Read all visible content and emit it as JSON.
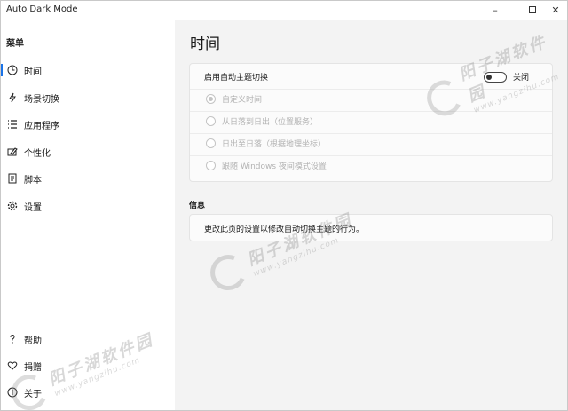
{
  "window": {
    "title": "Auto Dark Mode",
    "minimize": "–",
    "close": "✕"
  },
  "sidebar": {
    "header": "菜单",
    "items": [
      {
        "label": "时间",
        "icon": "clock-icon"
      },
      {
        "label": "场景切换",
        "icon": "lightning-icon"
      },
      {
        "label": "应用程序",
        "icon": "list-icon"
      },
      {
        "label": "个性化",
        "icon": "paint-icon"
      },
      {
        "label": "脚本",
        "icon": "script-icon"
      },
      {
        "label": "设置",
        "icon": "gear-icon"
      }
    ],
    "footer": [
      {
        "label": "帮助",
        "icon": "question-icon"
      },
      {
        "label": "捐赠",
        "icon": "heart-icon"
      },
      {
        "label": "关于",
        "icon": "info-icon"
      }
    ]
  },
  "main": {
    "title": "时间",
    "auto_switch": {
      "label": "启用自动主题切换",
      "toggle_label": "关闭",
      "enabled": false
    },
    "options": [
      {
        "label": "自定义时间",
        "checked": true
      },
      {
        "label": "从日落到日出（位置服务）",
        "checked": false
      },
      {
        "label": "日出至日落（根据地理坐标）",
        "checked": false
      },
      {
        "label": "跟随 Windows 夜间模式设置",
        "checked": false
      }
    ],
    "info_section": {
      "header": "信息",
      "text": "更改此页的设置以修改自动切换主题的行为。"
    }
  },
  "watermark": {
    "cn": "阳子湖软件园",
    "url": "www.yangzihu.com"
  },
  "colors": {
    "accent": "#1a73e8",
    "main_bg": "#f3f3f3",
    "card_bg": "#fbfbfb",
    "disabled_text": "#b3b3b3"
  }
}
